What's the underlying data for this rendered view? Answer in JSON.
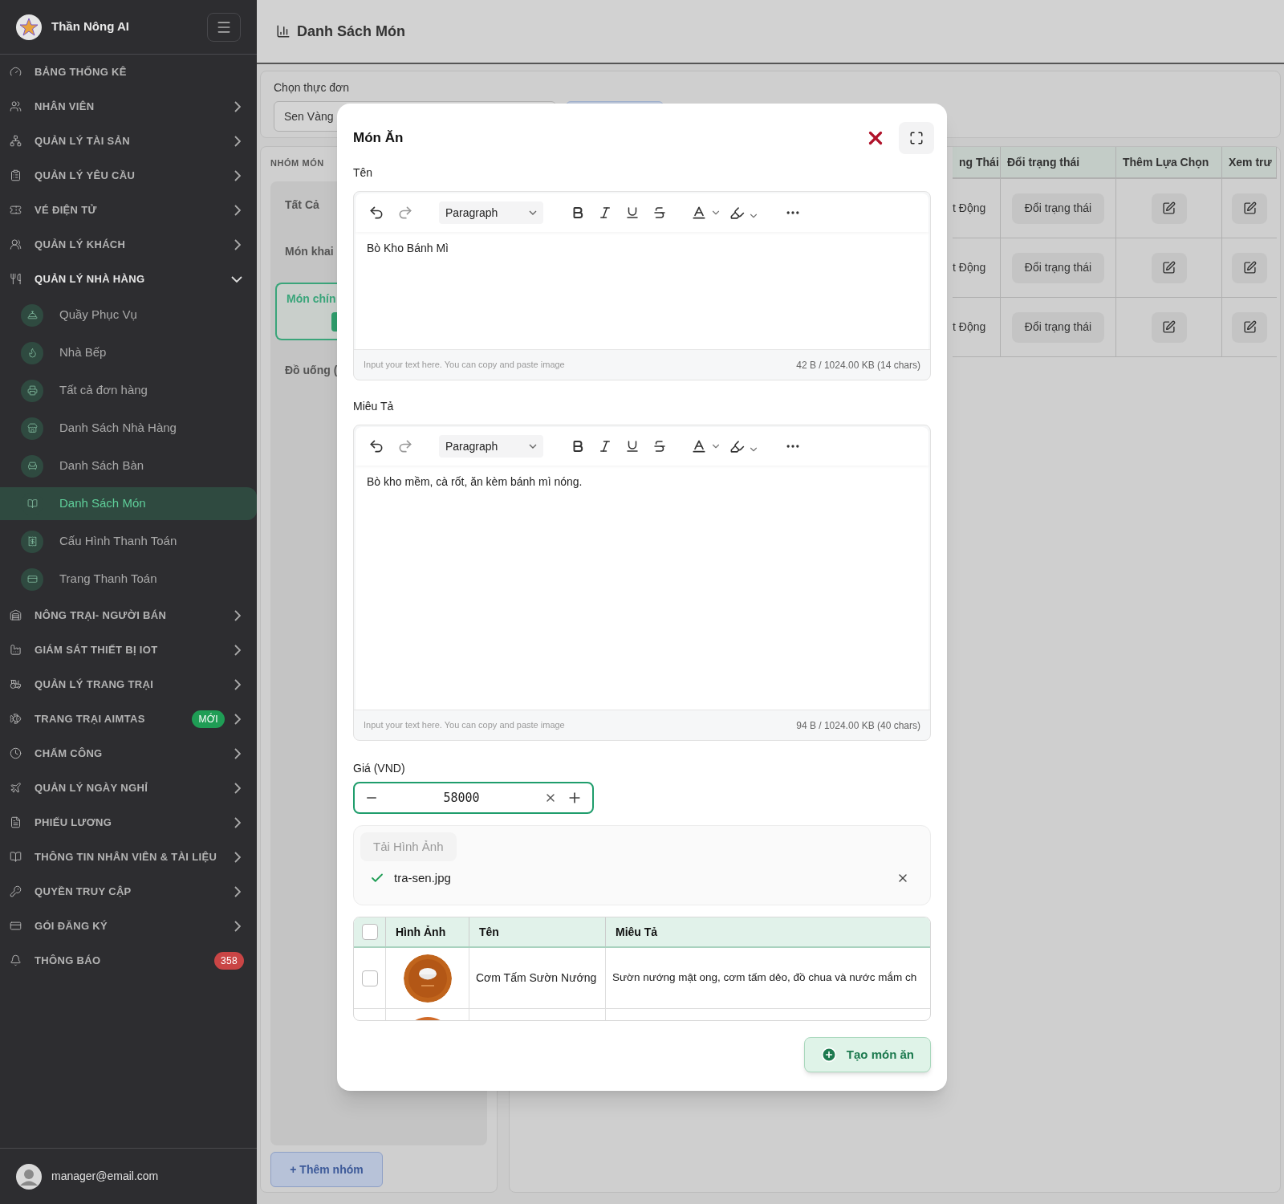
{
  "sidebar": {
    "brand": "Thần Nông AI",
    "items": [
      {
        "label": "BẢNG THỐNG KÊ"
      },
      {
        "label": "NHÂN VIÊN",
        "expanded": false
      },
      {
        "label": "QUẢN LÝ TÀI SẢN",
        "expanded": false
      },
      {
        "label": "QUẢN LÝ YÊU CẦU",
        "expanded": false
      },
      {
        "label": "VÉ ĐIỆN TỬ",
        "expanded": false
      },
      {
        "label": "QUẢN LÝ KHÁCH",
        "expanded": false
      },
      {
        "label": "QUẢN LÝ NHÀ HÀNG",
        "expanded": true,
        "children": [
          {
            "label": "Quầy Phục Vụ",
            "selected": false
          },
          {
            "label": "Nhà Bếp",
            "selected": false
          },
          {
            "label": "Tất cả đơn hàng",
            "selected": false
          },
          {
            "label": "Danh Sách Nhà Hàng",
            "selected": false
          },
          {
            "label": "Danh Sách Bàn",
            "selected": false
          },
          {
            "label": "Danh Sách Món",
            "selected": true
          },
          {
            "label": "Cấu Hình Thanh Toán",
            "selected": false
          },
          {
            "label": "Trang Thanh Toán",
            "selected": false
          }
        ]
      },
      {
        "label": "NÔNG TRẠI- NGƯỜI BÁN",
        "expanded": false
      },
      {
        "label": "GIÁM SÁT THIẾT BỊ IOT",
        "expanded": false
      },
      {
        "label": "QUẢN LÝ TRANG TRẠI",
        "expanded": false
      },
      {
        "label": "TRANG TRẠI AIMTAS",
        "expanded": false,
        "badge": {
          "text": "MỚI",
          "color": "#1f9d55"
        }
      },
      {
        "label": "CHẤM CÔNG",
        "expanded": false
      },
      {
        "label": "QUẢN LÝ NGÀY NGHỈ",
        "expanded": false
      },
      {
        "label": "PHIẾU LƯƠNG",
        "expanded": false
      },
      {
        "label": "THÔNG TIN NHÂN VIÊN & TÀI LIỆU",
        "expanded": false
      },
      {
        "label": "QUYỀN TRUY CẬP",
        "expanded": false
      },
      {
        "label": "GÓI ĐĂNG KÝ",
        "expanded": false
      },
      {
        "label": "THÔNG BÁO",
        "badge": {
          "text": "358",
          "color": "#c94545"
        }
      }
    ],
    "user": "manager@email.com"
  },
  "header": {
    "title": "Danh Sách Món"
  },
  "menu_picker": {
    "label": "Chọn thực đơn",
    "value": "Sen Vàng"
  },
  "groups": {
    "heading": "NHÓM MÓN",
    "items": [
      {
        "label": "Tất Cả",
        "selected": false
      },
      {
        "label": "Món khai",
        "selected": false
      },
      {
        "label": "Món chín",
        "selected": true
      },
      {
        "label": "Đồ uống (",
        "selected": false
      }
    ],
    "add_button": "+ Thêm nhóm"
  },
  "dish_table": {
    "columns": [
      "ng Thái",
      "Đổi trạng thái",
      "Thêm Lựa Chọn",
      "Xem trư"
    ],
    "rows": [
      {
        "status": "t Động",
        "action": "Đổi trạng thái"
      },
      {
        "status": "t Động",
        "action": "Đổi trạng thái"
      },
      {
        "status": "t Động",
        "action": "Đổi trạng thái"
      }
    ]
  },
  "modal": {
    "title": "Món Ăn",
    "editors": [
      {
        "label": "Tên",
        "format": "Paragraph",
        "text": "Bò Kho Bánh Mì",
        "hint": "Input your text here. You can copy and paste image",
        "stats": "42 B / 1024.00 KB (14 chars)"
      },
      {
        "label": "Miêu Tả",
        "format": "Paragraph",
        "text": "Bò kho mềm, cà rốt, ăn kèm bánh mì nóng.",
        "hint": "Input your text here. You can copy and paste image",
        "stats": "94 B / 1024.00 KB (40 chars)"
      }
    ],
    "price": {
      "label": "Giá (VND)",
      "value": "58000"
    },
    "upload": {
      "button": "Tải Hình Ảnh",
      "file": "tra-sen.jpg"
    },
    "table": {
      "all_checked": false,
      "columns": [
        "Hình Ảnh",
        "Tên",
        "Miêu Tả"
      ],
      "rows": [
        {
          "kind": "full",
          "checked": false,
          "name": "Cơm Tấm Sườn Nướng",
          "description": "Sườn nướng mật ong, cơm tấm dẻo, đồ chua và nước mắm ch"
        },
        {
          "kind": "clipped"
        }
      ]
    },
    "submit": "Tạo món ăn"
  }
}
